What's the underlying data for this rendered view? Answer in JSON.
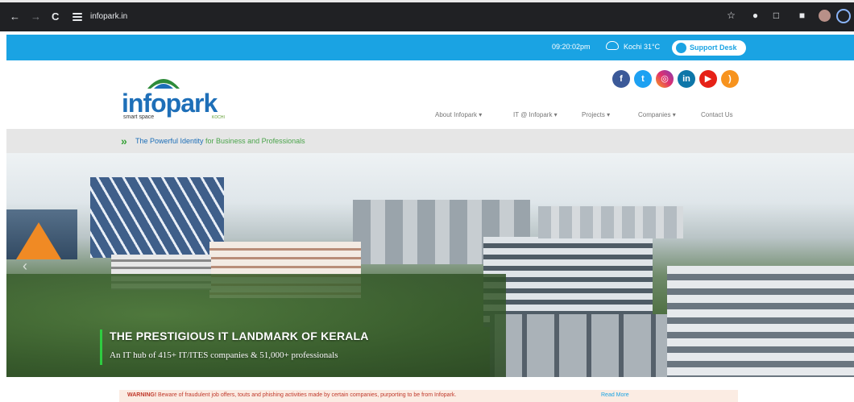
{
  "browser": {
    "url": "infopark.in",
    "icons": [
      "back-arrow-icon",
      "forward-arrow-icon",
      "reload-icon",
      "site-info-icon",
      "star-icon",
      "extension-icon",
      "puzzle-icon",
      "sidebar-icon",
      "profile-avatar",
      "chrome-menu-icon"
    ]
  },
  "topbar": {
    "time": "09:20:02pm",
    "weather": "Kochi 31°C",
    "support_label": "Support Desk"
  },
  "header": {
    "logo_word": "infopark",
    "logo_tagline": "smart space",
    "logo_location": "KOCHI",
    "social": [
      "facebook",
      "twitter",
      "instagram",
      "linkedin",
      "youtube",
      "rss"
    ],
    "menu": [
      "About Infopark ▾",
      "IT @ Infopark ▾",
      "Projects ▾",
      "Companies ▾",
      "Contact Us"
    ]
  },
  "tagline": {
    "part1": "The Powerful Identity",
    "part2": " for Business and Professionals"
  },
  "hero": {
    "headline": "THE PRESTIGIOUS IT LANDMARK OF KERALA",
    "subline": "An IT hub of 415+ IT/ITES companies & 51,000+ professionals"
  },
  "warning": {
    "label": "WARNING!",
    "text": "Beware of fraudulent job offers, touts and phishing activities made by certain companies, purporting to be from Infopark.",
    "link": "Read More"
  },
  "colors": {
    "brand_blue": "#1aa3e3",
    "logo_blue": "#1e6fb8",
    "tag_green": "#4aa34a"
  }
}
